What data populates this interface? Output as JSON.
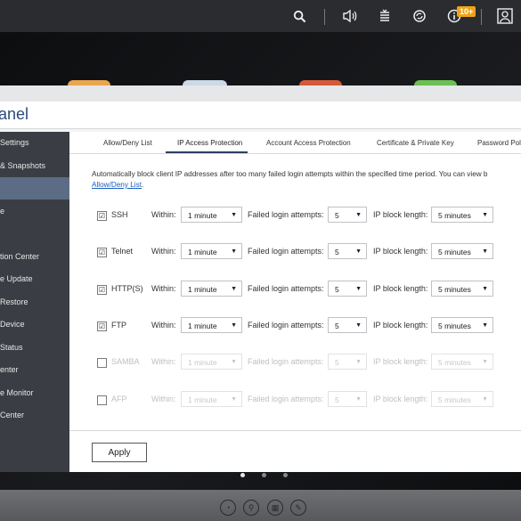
{
  "topbar": {
    "icons": [
      "search-icon",
      "volume-icon",
      "task-stack-icon",
      "sync-icon",
      "info-icon",
      "user-icon"
    ],
    "badge": "10+"
  },
  "window": {
    "title": "anel",
    "colors": {
      "accent": "#2c3e63",
      "sidebar_bg": "#3a3e44",
      "sidebar_active": "#5c6c86",
      "link": "#1b5fc4"
    }
  },
  "sidebar": {
    "items": [
      {
        "label": "Settings"
      },
      {
        "label": "& Snapshots"
      },
      {
        "label": ""
      },
      {
        "label": "e"
      },
      {
        "label": ""
      },
      {
        "label": "tion Center"
      },
      {
        "label": "e Update"
      },
      {
        "label": "Restore"
      },
      {
        "label": "Device"
      },
      {
        "label": "Status"
      },
      {
        "label": "enter"
      },
      {
        "label": "e Monitor"
      },
      {
        "label": "Center"
      }
    ],
    "active_index": 2
  },
  "tabs": [
    {
      "label": "Allow/Deny List"
    },
    {
      "label": "IP Access Protection"
    },
    {
      "label": "Account Access Protection"
    },
    {
      "label": "Certificate & Private Key"
    },
    {
      "label": "Password Pol"
    }
  ],
  "description": {
    "text": "Automatically block client IP addresses after too many failed login attempts within the specified time period. You can view b",
    "link": "Allow/Deny List",
    "suffix": "."
  },
  "labels": {
    "within": "Within:",
    "attempts": "Failed login attempts:",
    "block": "IP block length:"
  },
  "rows": [
    {
      "name": "SSH",
      "checked": true,
      "check": "☑",
      "within": "1 minute",
      "attempts": "5",
      "block": "5 minutes"
    },
    {
      "name": "Telnet",
      "checked": true,
      "check": "☑",
      "within": "1 minute",
      "attempts": "5",
      "block": "5 minutes"
    },
    {
      "name": "HTTP(S)",
      "checked": true,
      "check": "☑",
      "within": "1 minute",
      "attempts": "5",
      "block": "5 minutes"
    },
    {
      "name": "FTP",
      "checked": true,
      "check": "☑",
      "within": "1 minute",
      "attempts": "5",
      "block": "5 minutes"
    },
    {
      "name": "SAMBA",
      "checked": false,
      "check": "",
      "within": "1 minute",
      "attempts": "5",
      "block": "5 minutes"
    },
    {
      "name": "AFP",
      "checked": false,
      "check": "",
      "within": "1 minute",
      "attempts": "5",
      "block": "5 minutes"
    }
  ],
  "apply_label": "Apply",
  "pager": {
    "count": 3,
    "active": 0
  },
  "dock": {
    "icons": [
      "dashboard-icon",
      "search-dock-icon",
      "apps-icon",
      "notes-icon"
    ]
  }
}
